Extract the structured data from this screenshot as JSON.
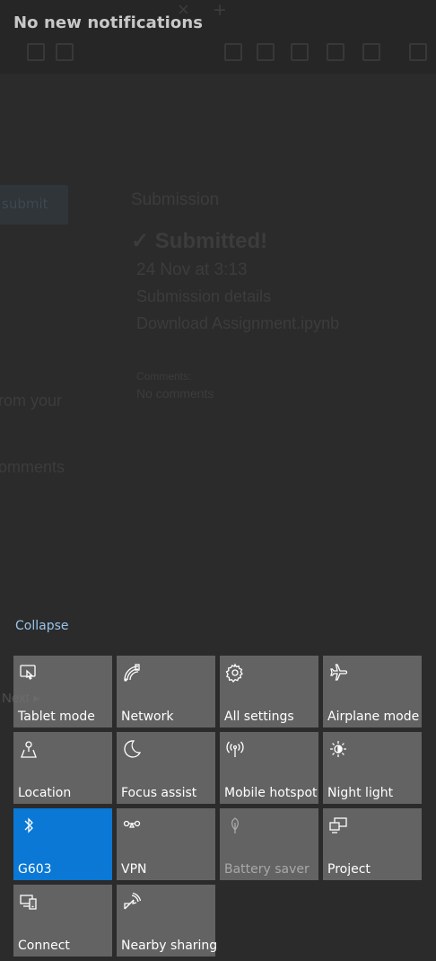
{
  "action_center": {
    "header": "No new notifications",
    "collapse_label": "Collapse",
    "accent_color": "#0a78d4",
    "tiles": [
      {
        "label": "Tablet mode",
        "icon": "tablet-mode-icon",
        "state": "off"
      },
      {
        "label": "Network",
        "icon": "network-icon",
        "state": "off"
      },
      {
        "label": "All settings",
        "icon": "gear-icon",
        "state": "off"
      },
      {
        "label": "Airplane mode",
        "icon": "airplane-icon",
        "state": "off"
      },
      {
        "label": "Location",
        "icon": "location-icon",
        "state": "off"
      },
      {
        "label": "Focus assist",
        "icon": "moon-icon",
        "state": "off"
      },
      {
        "label": "Mobile hotspot",
        "icon": "hotspot-icon",
        "state": "off"
      },
      {
        "label": "Night light",
        "icon": "night-light-icon",
        "state": "off"
      },
      {
        "label": "G603",
        "icon": "bluetooth-icon",
        "state": "on"
      },
      {
        "label": "VPN",
        "icon": "vpn-icon",
        "state": "off"
      },
      {
        "label": "Battery saver",
        "icon": "battery-saver-icon",
        "state": "disabled"
      },
      {
        "label": "Project",
        "icon": "project-icon",
        "state": "off"
      },
      {
        "label": "Connect",
        "icon": "connect-icon",
        "state": "off"
      },
      {
        "label": "Nearby sharing",
        "icon": "nearby-sharing-icon",
        "state": "off"
      }
    ]
  },
  "background_page": {
    "submission_heading": "Submission",
    "submitted_text": "Submitted!",
    "date_text": "24 Nov at 3:13",
    "details_link": "Submission details",
    "download_link": "Download Assignment.ipynb",
    "comments_label": "Comments:",
    "no_comments": "No comments",
    "left_text_1": "rom your",
    "left_text_2": "omments",
    "next_link": "Next ▸"
  }
}
